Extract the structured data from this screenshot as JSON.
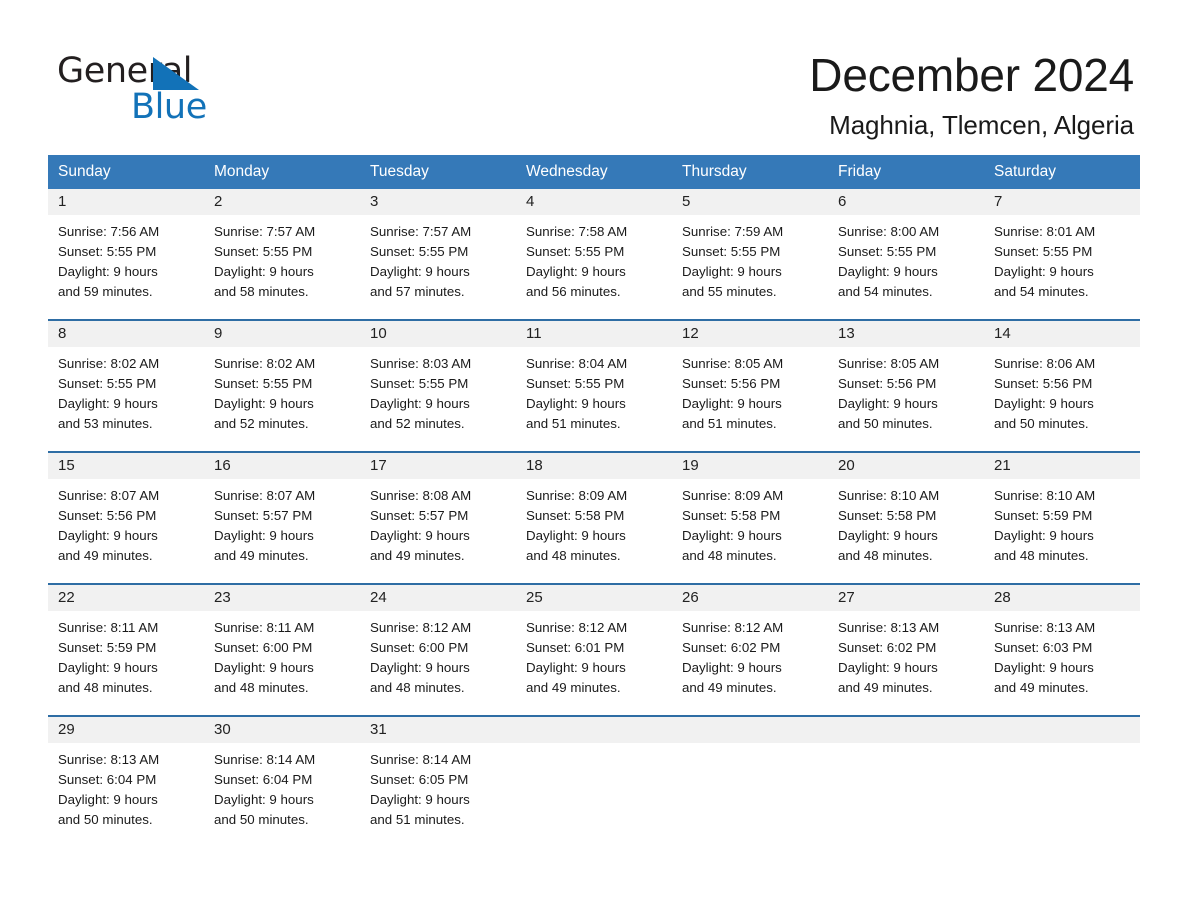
{
  "brand": {
    "logo_text_primary": "General",
    "logo_text_secondary": "Blue",
    "logo_triangle_color": "#1272b8",
    "accent_color": "#3579b8",
    "week_border_color": "#2e6da4",
    "day_band_color": "#f1f1f1"
  },
  "header": {
    "title": "December 2024",
    "subtitle": "Maghnia, Tlemcen, Algeria"
  },
  "weekdays": [
    "Sunday",
    "Monday",
    "Tuesday",
    "Wednesday",
    "Thursday",
    "Friday",
    "Saturday"
  ],
  "weeks": [
    {
      "days": [
        {
          "num": "1",
          "sunrise": "Sunrise: 7:56 AM",
          "sunset": "Sunset: 5:55 PM",
          "daylight_1": "Daylight: 9 hours",
          "daylight_2": "and 59 minutes."
        },
        {
          "num": "2",
          "sunrise": "Sunrise: 7:57 AM",
          "sunset": "Sunset: 5:55 PM",
          "daylight_1": "Daylight: 9 hours",
          "daylight_2": "and 58 minutes."
        },
        {
          "num": "3",
          "sunrise": "Sunrise: 7:57 AM",
          "sunset": "Sunset: 5:55 PM",
          "daylight_1": "Daylight: 9 hours",
          "daylight_2": "and 57 minutes."
        },
        {
          "num": "4",
          "sunrise": "Sunrise: 7:58 AM",
          "sunset": "Sunset: 5:55 PM",
          "daylight_1": "Daylight: 9 hours",
          "daylight_2": "and 56 minutes."
        },
        {
          "num": "5",
          "sunrise": "Sunrise: 7:59 AM",
          "sunset": "Sunset: 5:55 PM",
          "daylight_1": "Daylight: 9 hours",
          "daylight_2": "and 55 minutes."
        },
        {
          "num": "6",
          "sunrise": "Sunrise: 8:00 AM",
          "sunset": "Sunset: 5:55 PM",
          "daylight_1": "Daylight: 9 hours",
          "daylight_2": "and 54 minutes."
        },
        {
          "num": "7",
          "sunrise": "Sunrise: 8:01 AM",
          "sunset": "Sunset: 5:55 PM",
          "daylight_1": "Daylight: 9 hours",
          "daylight_2": "and 54 minutes."
        }
      ]
    },
    {
      "days": [
        {
          "num": "8",
          "sunrise": "Sunrise: 8:02 AM",
          "sunset": "Sunset: 5:55 PM",
          "daylight_1": "Daylight: 9 hours",
          "daylight_2": "and 53 minutes."
        },
        {
          "num": "9",
          "sunrise": "Sunrise: 8:02 AM",
          "sunset": "Sunset: 5:55 PM",
          "daylight_1": "Daylight: 9 hours",
          "daylight_2": "and 52 minutes."
        },
        {
          "num": "10",
          "sunrise": "Sunrise: 8:03 AM",
          "sunset": "Sunset: 5:55 PM",
          "daylight_1": "Daylight: 9 hours",
          "daylight_2": "and 52 minutes."
        },
        {
          "num": "11",
          "sunrise": "Sunrise: 8:04 AM",
          "sunset": "Sunset: 5:55 PM",
          "daylight_1": "Daylight: 9 hours",
          "daylight_2": "and 51 minutes."
        },
        {
          "num": "12",
          "sunrise": "Sunrise: 8:05 AM",
          "sunset": "Sunset: 5:56 PM",
          "daylight_1": "Daylight: 9 hours",
          "daylight_2": "and 51 minutes."
        },
        {
          "num": "13",
          "sunrise": "Sunrise: 8:05 AM",
          "sunset": "Sunset: 5:56 PM",
          "daylight_1": "Daylight: 9 hours",
          "daylight_2": "and 50 minutes."
        },
        {
          "num": "14",
          "sunrise": "Sunrise: 8:06 AM",
          "sunset": "Sunset: 5:56 PM",
          "daylight_1": "Daylight: 9 hours",
          "daylight_2": "and 50 minutes."
        }
      ]
    },
    {
      "days": [
        {
          "num": "15",
          "sunrise": "Sunrise: 8:07 AM",
          "sunset": "Sunset: 5:56 PM",
          "daylight_1": "Daylight: 9 hours",
          "daylight_2": "and 49 minutes."
        },
        {
          "num": "16",
          "sunrise": "Sunrise: 8:07 AM",
          "sunset": "Sunset: 5:57 PM",
          "daylight_1": "Daylight: 9 hours",
          "daylight_2": "and 49 minutes."
        },
        {
          "num": "17",
          "sunrise": "Sunrise: 8:08 AM",
          "sunset": "Sunset: 5:57 PM",
          "daylight_1": "Daylight: 9 hours",
          "daylight_2": "and 49 minutes."
        },
        {
          "num": "18",
          "sunrise": "Sunrise: 8:09 AM",
          "sunset": "Sunset: 5:58 PM",
          "daylight_1": "Daylight: 9 hours",
          "daylight_2": "and 48 minutes."
        },
        {
          "num": "19",
          "sunrise": "Sunrise: 8:09 AM",
          "sunset": "Sunset: 5:58 PM",
          "daylight_1": "Daylight: 9 hours",
          "daylight_2": "and 48 minutes."
        },
        {
          "num": "20",
          "sunrise": "Sunrise: 8:10 AM",
          "sunset": "Sunset: 5:58 PM",
          "daylight_1": "Daylight: 9 hours",
          "daylight_2": "and 48 minutes."
        },
        {
          "num": "21",
          "sunrise": "Sunrise: 8:10 AM",
          "sunset": "Sunset: 5:59 PM",
          "daylight_1": "Daylight: 9 hours",
          "daylight_2": "and 48 minutes."
        }
      ]
    },
    {
      "days": [
        {
          "num": "22",
          "sunrise": "Sunrise: 8:11 AM",
          "sunset": "Sunset: 5:59 PM",
          "daylight_1": "Daylight: 9 hours",
          "daylight_2": "and 48 minutes."
        },
        {
          "num": "23",
          "sunrise": "Sunrise: 8:11 AM",
          "sunset": "Sunset: 6:00 PM",
          "daylight_1": "Daylight: 9 hours",
          "daylight_2": "and 48 minutes."
        },
        {
          "num": "24",
          "sunrise": "Sunrise: 8:12 AM",
          "sunset": "Sunset: 6:00 PM",
          "daylight_1": "Daylight: 9 hours",
          "daylight_2": "and 48 minutes."
        },
        {
          "num": "25",
          "sunrise": "Sunrise: 8:12 AM",
          "sunset": "Sunset: 6:01 PM",
          "daylight_1": "Daylight: 9 hours",
          "daylight_2": "and 49 minutes."
        },
        {
          "num": "26",
          "sunrise": "Sunrise: 8:12 AM",
          "sunset": "Sunset: 6:02 PM",
          "daylight_1": "Daylight: 9 hours",
          "daylight_2": "and 49 minutes."
        },
        {
          "num": "27",
          "sunrise": "Sunrise: 8:13 AM",
          "sunset": "Sunset: 6:02 PM",
          "daylight_1": "Daylight: 9 hours",
          "daylight_2": "and 49 minutes."
        },
        {
          "num": "28",
          "sunrise": "Sunrise: 8:13 AM",
          "sunset": "Sunset: 6:03 PM",
          "daylight_1": "Daylight: 9 hours",
          "daylight_2": "and 49 minutes."
        }
      ]
    },
    {
      "days": [
        {
          "num": "29",
          "sunrise": "Sunrise: 8:13 AM",
          "sunset": "Sunset: 6:04 PM",
          "daylight_1": "Daylight: 9 hours",
          "daylight_2": "and 50 minutes."
        },
        {
          "num": "30",
          "sunrise": "Sunrise: 8:14 AM",
          "sunset": "Sunset: 6:04 PM",
          "daylight_1": "Daylight: 9 hours",
          "daylight_2": "and 50 minutes."
        },
        {
          "num": "31",
          "sunrise": "Sunrise: 8:14 AM",
          "sunset": "Sunset: 6:05 PM",
          "daylight_1": "Daylight: 9 hours",
          "daylight_2": "and 51 minutes."
        },
        {
          "num": "",
          "sunrise": "",
          "sunset": "",
          "daylight_1": "",
          "daylight_2": "",
          "empty": true
        },
        {
          "num": "",
          "sunrise": "",
          "sunset": "",
          "daylight_1": "",
          "daylight_2": "",
          "empty": true
        },
        {
          "num": "",
          "sunrise": "",
          "sunset": "",
          "daylight_1": "",
          "daylight_2": "",
          "empty": true
        },
        {
          "num": "",
          "sunrise": "",
          "sunset": "",
          "daylight_1": "",
          "daylight_2": "",
          "empty": true
        }
      ]
    }
  ]
}
